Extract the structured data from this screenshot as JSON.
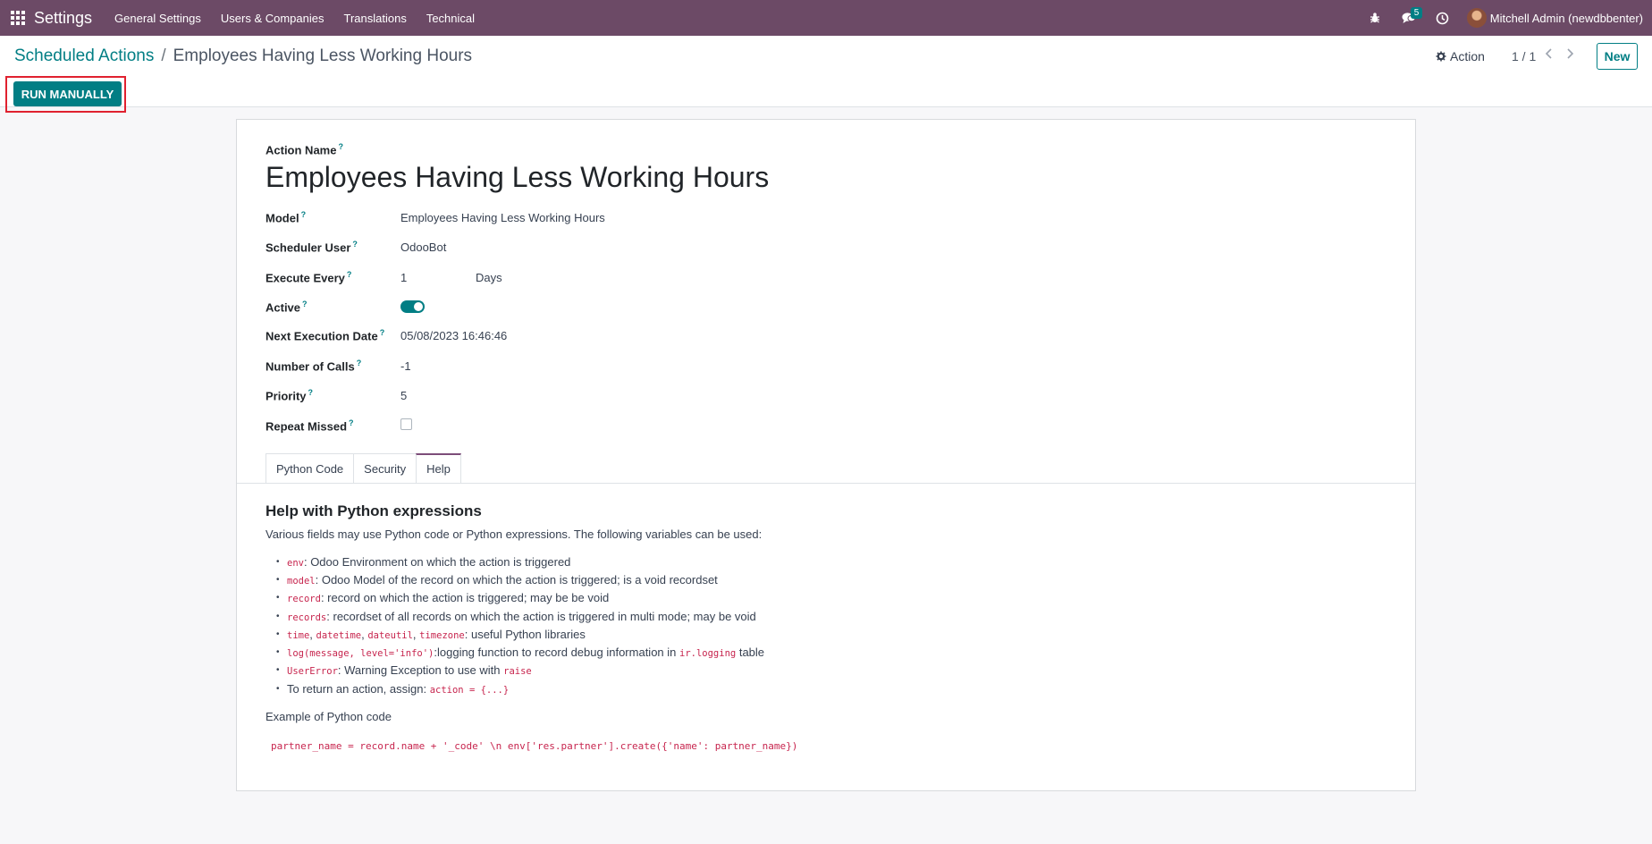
{
  "navbar": {
    "brand": "Settings",
    "menu": [
      "General Settings",
      "Users & Companies",
      "Translations",
      "Technical"
    ],
    "messages_count": "5",
    "user": "Mitchell Admin (newdbbenter)"
  },
  "breadcrumb": {
    "parent": "Scheduled Actions",
    "separator": "/",
    "current": "Employees Having Less Working Hours"
  },
  "controls": {
    "action_label": "Action",
    "pager": "1 / 1",
    "new_label": "New",
    "run_label": "RUN MANUALLY"
  },
  "form": {
    "name_label": "Action Name",
    "help_mark": "?",
    "title": "Employees Having Less Working Hours",
    "fields": {
      "model": {
        "label": "Model",
        "value": "Employees Having Less Working Hours"
      },
      "user": {
        "label": "Scheduler User",
        "value": "OdooBot"
      },
      "interval": {
        "label": "Execute Every",
        "value": "1",
        "unit": "Days"
      },
      "active": {
        "label": "Active",
        "value": true
      },
      "next_date": {
        "label": "Next Execution Date",
        "value": "05/08/2023 16:46:46"
      },
      "calls": {
        "label": "Number of Calls",
        "value": "-1"
      },
      "priority": {
        "label": "Priority",
        "value": "5"
      },
      "repeat": {
        "label": "Repeat Missed",
        "value": false
      }
    },
    "tabs": [
      "Python Code",
      "Security",
      "Help"
    ],
    "active_tab": "Help"
  },
  "help": {
    "title": "Help with Python expressions",
    "intro": "Various fields may use Python code or Python expressions. The following variables can be used:",
    "items": [
      [
        {
          "code": "env"
        },
        {
          "text": ": Odoo Environment on which the action is triggered"
        }
      ],
      [
        {
          "code": "model"
        },
        {
          "text": ": Odoo Model of the record on which the action is triggered; is a void recordset"
        }
      ],
      [
        {
          "code": "record"
        },
        {
          "text": ": record on which the action is triggered; may be be void"
        }
      ],
      [
        {
          "code": "records"
        },
        {
          "text": ": recordset of all records on which the action is triggered in multi mode; may be void"
        }
      ],
      [
        {
          "code": "time"
        },
        {
          "text": ", "
        },
        {
          "code": "datetime"
        },
        {
          "text": ", "
        },
        {
          "code": "dateutil"
        },
        {
          "text": ", "
        },
        {
          "code": "timezone"
        },
        {
          "text": ": useful Python libraries"
        }
      ],
      [
        {
          "code": "log(message, level='info')"
        },
        {
          "text": ":logging function to record debug information in "
        },
        {
          "code": "ir.logging"
        },
        {
          "text": " table"
        }
      ],
      [
        {
          "code": "UserError"
        },
        {
          "text": ": Warning Exception to use with "
        },
        {
          "code": "raise"
        }
      ],
      [
        {
          "text": "To return an action, assign: "
        },
        {
          "code": "action = {...}"
        }
      ]
    ],
    "example_label": "Example of Python code",
    "example_code": "partner_name = record.name + '_code' \\n env['res.partner'].create({'name': partner_name})"
  }
}
